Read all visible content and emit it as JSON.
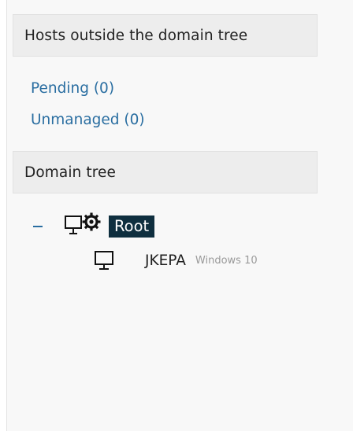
{
  "sections": {
    "outside": {
      "title": "Hosts outside the domain tree",
      "pending": "Pending (0)",
      "unmanaged": "Unmanaged (0)"
    },
    "domain_tree": {
      "title": "Domain tree",
      "root": {
        "label": "Root",
        "icon": "computer-gear-icon",
        "expanded": true,
        "selected": true,
        "children": [
          {
            "name": "JKEPA",
            "os": "Windows 10",
            "icon": "monitor-icon"
          }
        ]
      }
    }
  },
  "colors": {
    "link": "#2a6ea1",
    "selection_bg": "#0f2f3f",
    "header_bg": "#ededed"
  }
}
